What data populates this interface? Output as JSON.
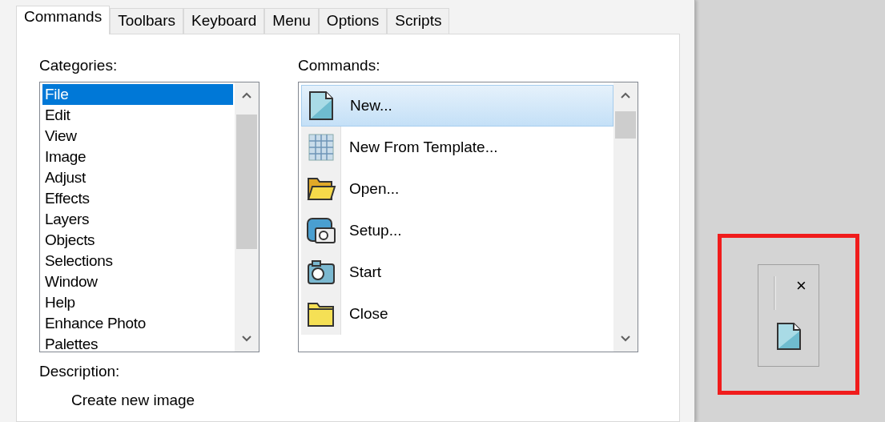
{
  "tabs": [
    {
      "label": "Commands",
      "selected": true
    },
    {
      "label": "Toolbars",
      "selected": false
    },
    {
      "label": "Keyboard",
      "selected": false
    },
    {
      "label": "Menu",
      "selected": false
    },
    {
      "label": "Options",
      "selected": false
    },
    {
      "label": "Scripts",
      "selected": false
    }
  ],
  "categories": {
    "label": "Categories:",
    "items": [
      {
        "label": "File",
        "selected": true
      },
      {
        "label": "Edit",
        "selected": false
      },
      {
        "label": "View",
        "selected": false
      },
      {
        "label": "Image",
        "selected": false
      },
      {
        "label": "Adjust",
        "selected": false
      },
      {
        "label": "Effects",
        "selected": false
      },
      {
        "label": "Layers",
        "selected": false
      },
      {
        "label": "Objects",
        "selected": false
      },
      {
        "label": "Selections",
        "selected": false
      },
      {
        "label": "Window",
        "selected": false
      },
      {
        "label": "Help",
        "selected": false
      },
      {
        "label": "Enhance Photo",
        "selected": false
      },
      {
        "label": "Palettes",
        "selected": false
      }
    ]
  },
  "commands": {
    "label": "Commands:",
    "items": [
      {
        "label": "New...",
        "kind": "page",
        "selected": true
      },
      {
        "label": "New From Template...",
        "kind": "grid",
        "selected": false
      },
      {
        "label": "Open...",
        "kind": "openfolder",
        "selected": false
      },
      {
        "label": "Setup...",
        "kind": "camerasetup",
        "selected": false
      },
      {
        "label": "Start",
        "kind": "camera",
        "selected": false
      },
      {
        "label": "Close",
        "kind": "folder",
        "selected": false
      }
    ]
  },
  "description": {
    "label": "Description:",
    "text": "Create new image"
  },
  "toolbar_preview": {
    "close": "×"
  }
}
